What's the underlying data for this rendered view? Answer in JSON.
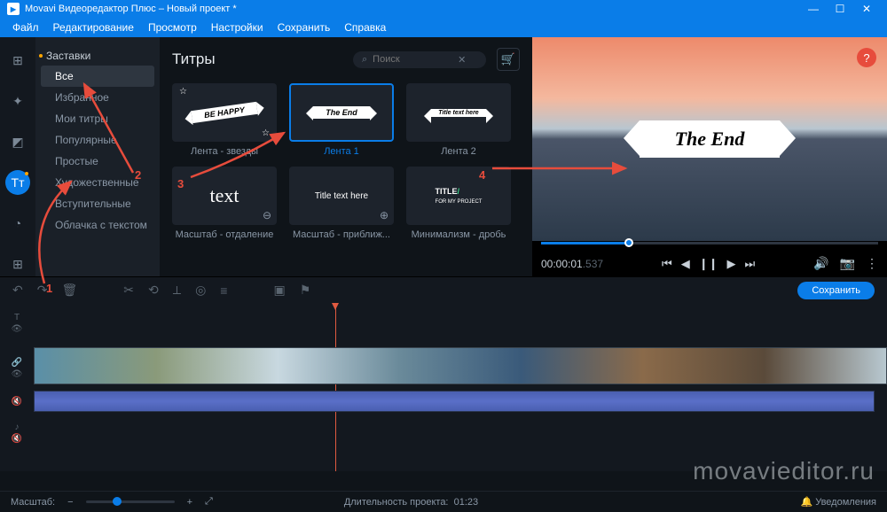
{
  "window": {
    "title": "Movavi Видеоредактор Плюс – Новый проект *"
  },
  "menu": {
    "file": "Файл",
    "edit": "Редактирование",
    "view": "Просмотр",
    "settings": "Настройки",
    "save": "Сохранить",
    "help": "Справка"
  },
  "iconbar": {
    "add": "add-media-icon",
    "fx": "effects-icon",
    "trans": "transitions-icon",
    "titles": "titles-icon",
    "titles_label": "Tᴛ",
    "stickers": "stickers-icon",
    "more": "more-icon"
  },
  "sidebar": {
    "category": "Заставки",
    "items": [
      "Все",
      "Избранное",
      "Мои титры",
      "Популярные",
      "Простые",
      "Художественные",
      "Вступительные",
      "Облачка с текстом"
    ],
    "active_index": 0
  },
  "content": {
    "heading": "Титры",
    "search_placeholder": "Поиск",
    "tiles": [
      {
        "label": "Лента - звезды",
        "thumb": "BE HAPPY",
        "kind": "ribbon-stars"
      },
      {
        "label": "Лента 1",
        "thumb": "The End",
        "kind": "ribbon",
        "selected": true
      },
      {
        "label": "Лента 2",
        "thumb": "Title text here",
        "kind": "ribbon-small"
      },
      {
        "label": "Масштаб - отдаление",
        "thumb": "text",
        "kind": "zoom-out"
      },
      {
        "label": "Масштаб - приближ...",
        "thumb": "Title text here",
        "kind": "zoom-in"
      },
      {
        "label": "Минимализм - дробь",
        "thumb": "TITLE/ FOR MY PROJECT",
        "kind": "minimal"
      }
    ]
  },
  "preview": {
    "ribbon_text": "The End",
    "time_current": "00:00:01",
    "time_frac": ".537"
  },
  "toolbar": {
    "save": "Сохранить"
  },
  "footer": {
    "zoom_label": "Масштаб:",
    "duration_label": "Длительность проекта:",
    "duration_value": "01:23",
    "notifications": "Уведомления"
  },
  "annotations": {
    "n1": "1",
    "n2": "2",
    "n3": "3",
    "n4": "4"
  },
  "watermark": "movavieditor.ru"
}
